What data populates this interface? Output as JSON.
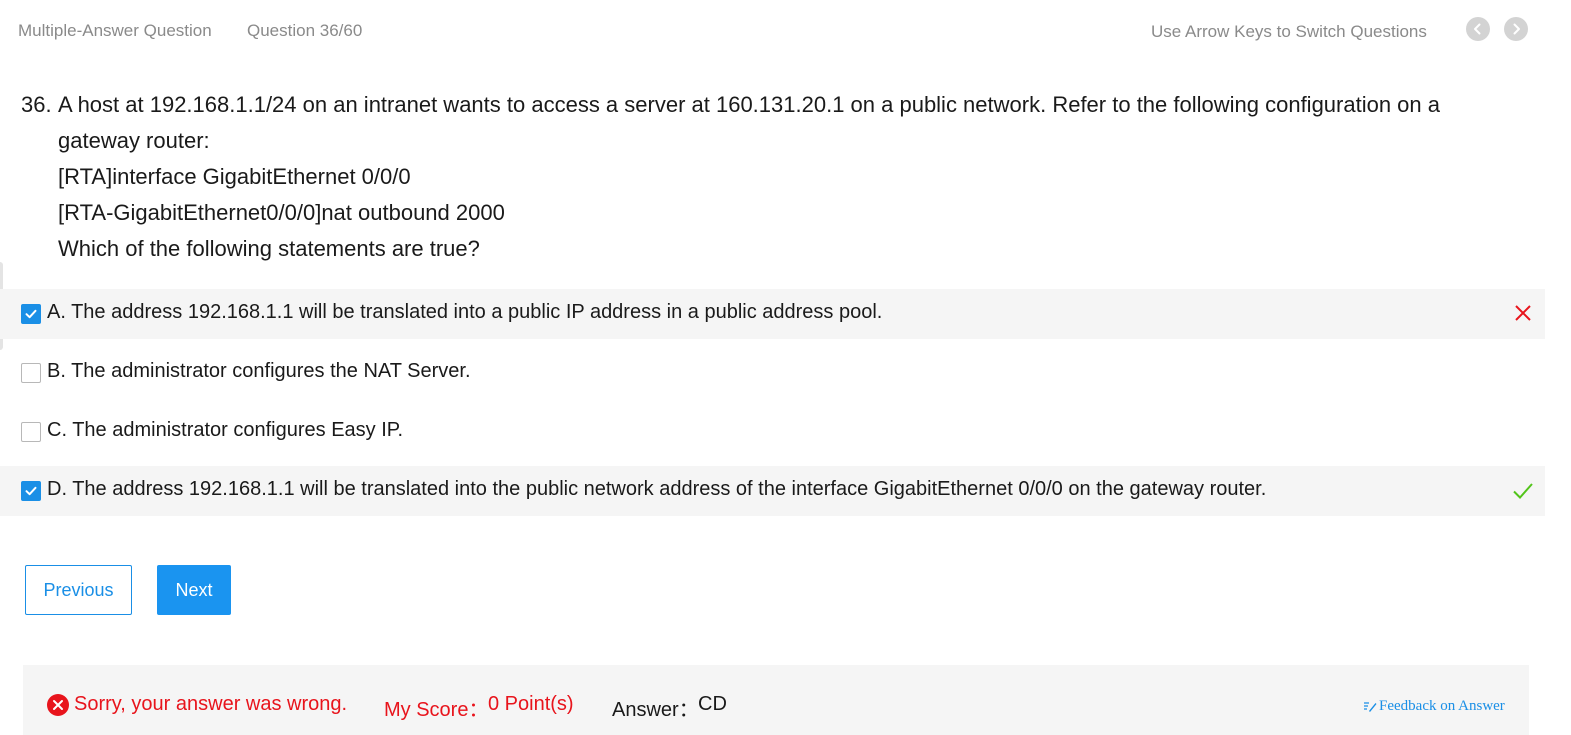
{
  "header": {
    "question_type": "Multiple-Answer Question",
    "question_progress": "Question 36/60",
    "hint": "Use Arrow Keys to Switch Questions",
    "prev_icon": "chevron-left-icon",
    "next_icon": "chevron-right-icon"
  },
  "question": {
    "number": "36.",
    "lines": [
      "A host at 192.168.1.1/24 on an intranet wants to access a server at 160.131.20.1 on a public network. Refer to the following configuration on a",
      "gateway router:",
      "[RTA]interface GigabitEthernet 0/0/0",
      "[RTA-GigabitEthernet0/0/0]nat outbound 2000",
      "Which of the following statements are true?"
    ]
  },
  "options": [
    {
      "text": "A. The address 192.168.1.1 will be translated into a public IP address in a public address pool.",
      "checked": true,
      "result": "wrong",
      "result_icon": "cross-icon"
    },
    {
      "text": "B. The administrator configures the NAT Server.",
      "checked": false,
      "result": ""
    },
    {
      "text": "C. The administrator configures Easy IP.",
      "checked": false,
      "result": ""
    },
    {
      "text": "D. The address 192.168.1.1 will be translated into the public network address of the interface GigabitEthernet 0/0/0 on the gateway router.",
      "checked": true,
      "result": "correct",
      "result_icon": "check-icon"
    }
  ],
  "buttons": {
    "previous": "Previous",
    "next": "Next"
  },
  "result": {
    "icon": "error-circle-icon",
    "message": "Sorry, your answer was wrong.",
    "score_label": "My Score：",
    "score_value": "0 Point(s)",
    "answer_label": "Answer：",
    "answer_value": "CD",
    "feedback_icon": "edit-note-icon",
    "feedback_link": "Feedback on Answer"
  },
  "colors": {
    "accent": "#1a8fe6",
    "error": "#e8141c",
    "success": "#52c41a",
    "muted": "#8a8a8a",
    "panel": "#f5f5f5"
  }
}
